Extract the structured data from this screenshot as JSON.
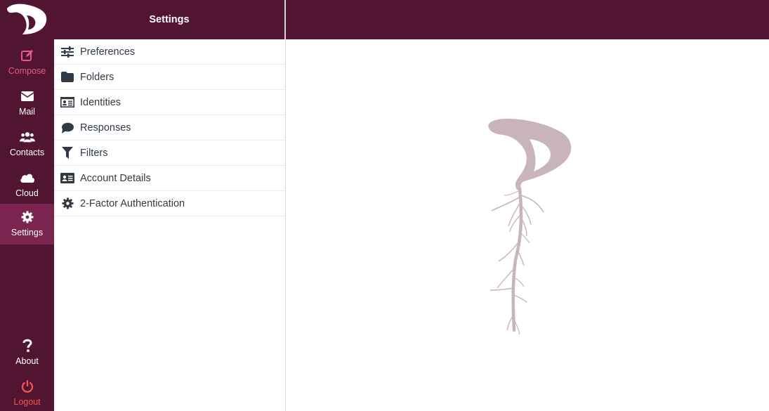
{
  "taskmenu": {
    "logo_icon": "dove-logo-icon",
    "items": [
      {
        "label": "Compose",
        "icon": "compose-icon"
      },
      {
        "label": "Mail",
        "icon": "envelope-icon"
      },
      {
        "label": "Contacts",
        "icon": "users-icon"
      },
      {
        "label": "Cloud",
        "icon": "cloud-icon"
      },
      {
        "label": "Settings",
        "icon": "gear-icon",
        "active": true
      }
    ],
    "footer": [
      {
        "label": "About",
        "icon": "question-icon"
      },
      {
        "label": "Logout",
        "icon": "power-icon"
      }
    ]
  },
  "sidebar": {
    "title": "Settings",
    "items": [
      {
        "label": "Preferences",
        "icon": "sliders-icon"
      },
      {
        "label": "Folders",
        "icon": "folder-icon"
      },
      {
        "label": "Identities",
        "icon": "id-card-icon"
      },
      {
        "label": "Responses",
        "icon": "comment-icon"
      },
      {
        "label": "Filters",
        "icon": "filter-icon"
      },
      {
        "label": "Account Details",
        "icon": "address-card-icon"
      },
      {
        "label": "2-Factor Authentication",
        "icon": "gear-icon"
      }
    ]
  },
  "colors": {
    "brand": "#521531",
    "active": "#7b2450",
    "compose": "#e85a8f",
    "logout": "#ff5252",
    "watermark": "#c9b3bd"
  }
}
